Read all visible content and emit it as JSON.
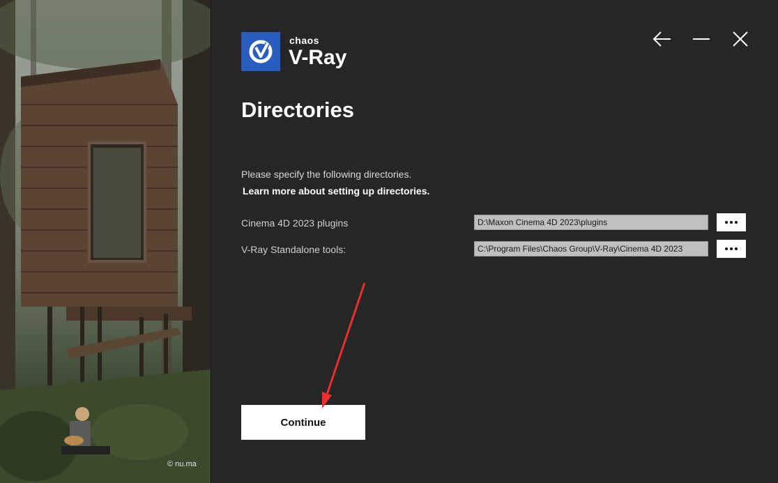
{
  "logo": {
    "brand": "chaos",
    "product": "V-Ray"
  },
  "window_controls": {
    "back_icon": "arrow-left-icon",
    "minimize_icon": "minimize-icon",
    "close_icon": "close-icon"
  },
  "page": {
    "title": "Directories",
    "intro": "Please specify the following directories.",
    "learn_more": "Learn more about setting up directories."
  },
  "directories": [
    {
      "label": "Cinema 4D 2023 plugins",
      "value": "D:\\Maxon Cinema 4D 2023\\plugins"
    },
    {
      "label": "V-Ray Standalone tools:",
      "value": "C:\\Program Files\\Chaos Group\\V-Ray\\Cinema 4D 2023"
    }
  ],
  "continue_label": "Continue",
  "art": {
    "credit": "© nu.ma"
  },
  "colors": {
    "accent": "#2b5cc0",
    "background": "#262626",
    "annotation": "#e8302c"
  }
}
